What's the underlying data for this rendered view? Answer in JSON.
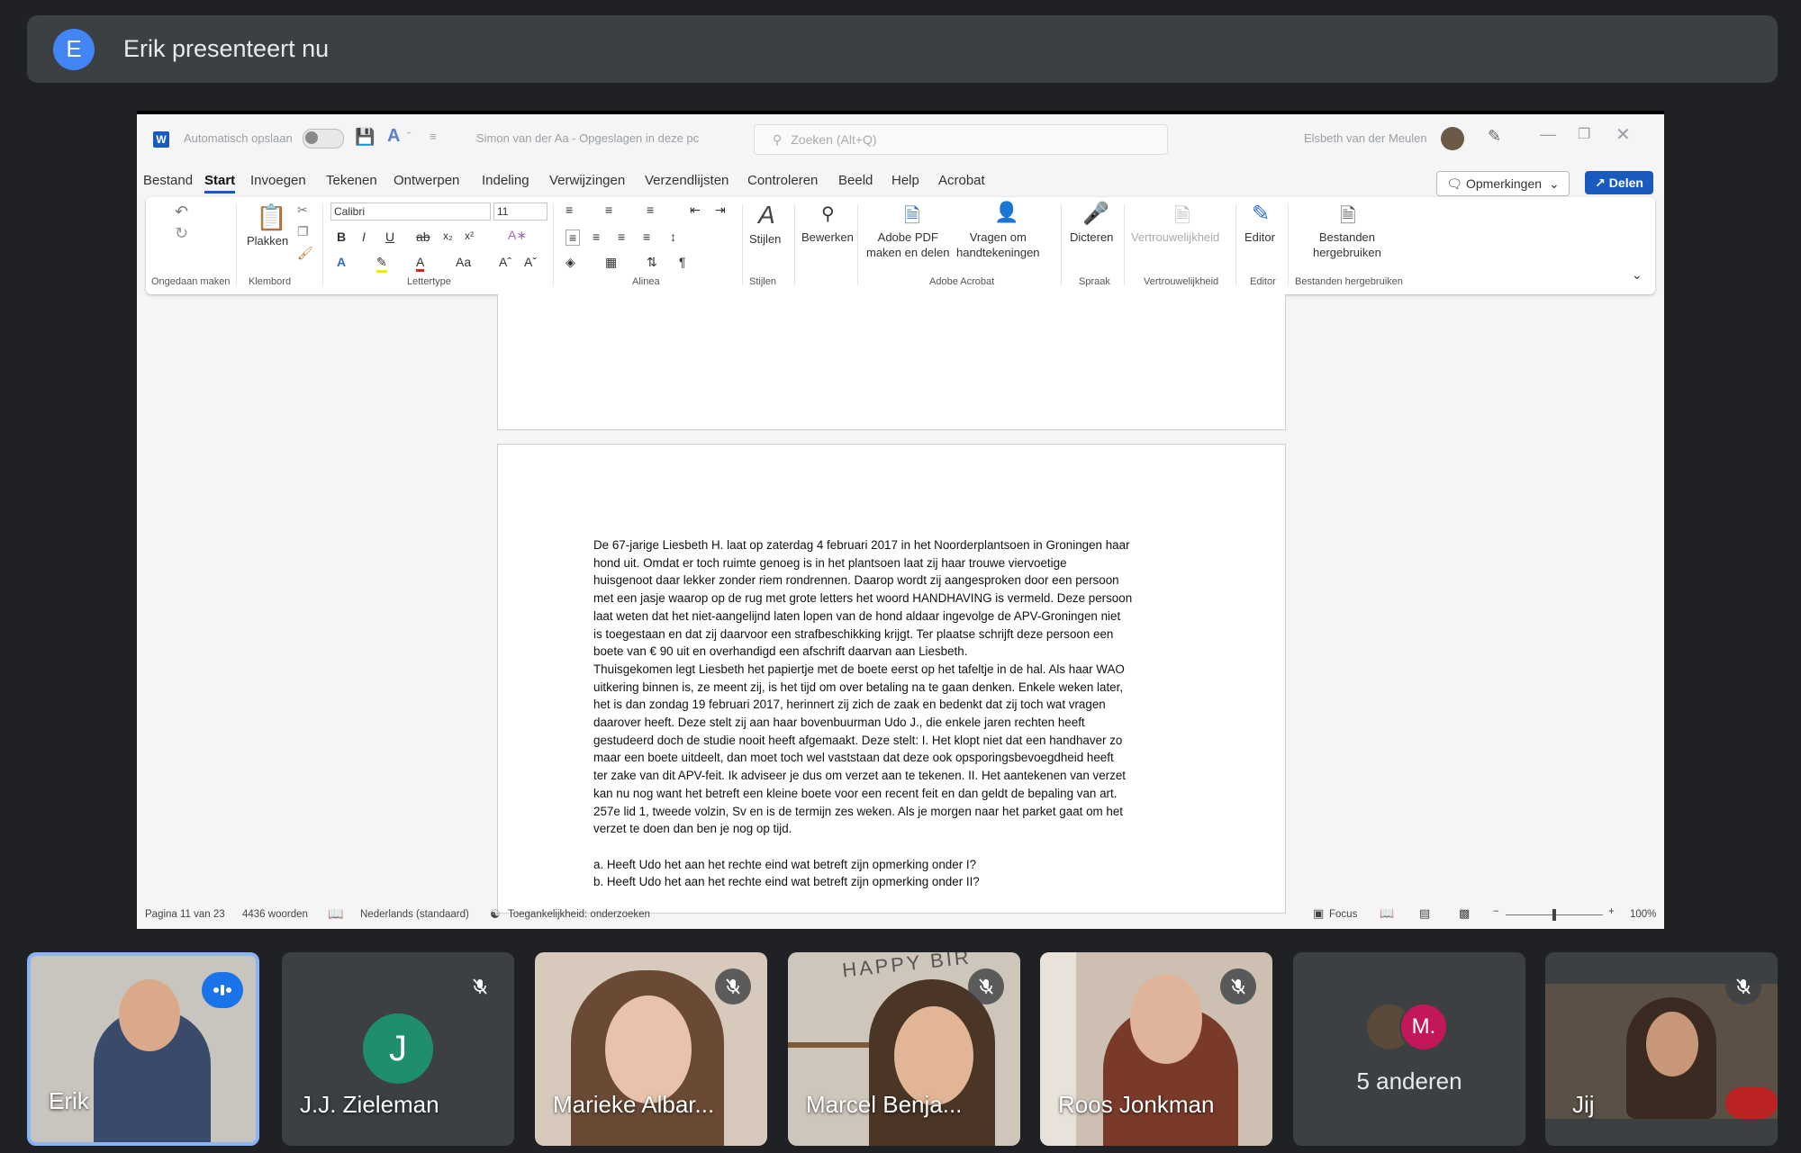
{
  "banner": {
    "avatar_letter": "E",
    "text": "Erik presenteert nu"
  },
  "word": {
    "autosave_label": "Automatisch opslaan",
    "doc_title": "Simon van der Aa  -  Opgeslagen in deze pc",
    "search_placeholder": "Zoeken (Alt+Q)",
    "user_name": "Elsbeth van der Meulen",
    "tabs": [
      "Bestand",
      "Start",
      "Invoegen",
      "Tekenen",
      "Ontwerpen",
      "Indeling",
      "Verwijzingen",
      "Verzendlijsten",
      "Controleren",
      "Beeld",
      "Help",
      "Acrobat"
    ],
    "comments_label": "Opmerkingen",
    "share_label": "Delen",
    "ribbon": {
      "paste_label": "Plakken",
      "font_name": "Calibri",
      "font_size": "11",
      "styles_label": "Stijlen",
      "edit_label": "Bewerken",
      "adobe_pdf_line1": "Adobe PDF",
      "adobe_pdf_line2": "maken en delen",
      "signatures_line1": "Vragen om",
      "signatures_line2": "handtekeningen",
      "dictate_label": "Dicteren",
      "sensitivity_label": "Vertrouwelijkheid",
      "editor_label": "Editor",
      "reuse_line1": "Bestanden",
      "reuse_line2": "hergebruiken",
      "groups": [
        "Ongedaan maken",
        "Klembord",
        "Lettertype",
        "Alinea",
        "Stijlen",
        "Adobe Acrobat",
        "Spraak",
        "Vertrouwelijkheid",
        "Editor",
        "Bestanden hergebruiken"
      ]
    },
    "document_lines": [
      "De 67-jarige Liesbeth H. laat op zaterdag 4 februari 2017 in het Noorderplantsoen in Groningen haar",
      "hond uit. Omdat er toch ruimte genoeg is in het plantsoen laat zij haar trouwe viervoetige",
      "huisgenoot daar lekker zonder riem rondrennen. Daarop wordt zij aangesproken door een persoon",
      "met een jasje waarop op de rug met grote letters het woord HANDHAVING is vermeld. Deze persoon",
      "laat weten dat het niet-aangelijnd laten lopen van de hond aldaar ingevolge de APV-Groningen niet",
      "is toegestaan en dat zij daarvoor een strafbeschikking krijgt. Ter plaatse schrijft deze persoon een",
      "boete van € 90 uit en overhandigd een afschrift daarvan aan Liesbeth.",
      "Thuisgekomen legt Liesbeth het papiertje met de boete eerst op het tafeltje in de hal. Als haar WAO",
      "uitkering binnen is, ze meent zij, is het tijd om over betaling na te gaan denken. Enkele weken later,",
      "het is dan zondag 19 februari 2017, herinnert zij zich de zaak en bedenkt dat zij toch wat vragen",
      "daarover heeft. Deze stelt zij aan haar bovenbuurman Udo J., die enkele jaren rechten heeft",
      "gestudeerd doch de studie nooit heeft afgemaakt. Deze stelt: I. Het klopt niet dat een handhaver zo",
      "maar een boete uitdeelt, dan moet toch wel vaststaan dat deze ook opsporingsbevoegdheid heeft",
      "ter zake van dit APV-feit. Ik adviseer je dus om verzet aan te tekenen. II. Het aantekenen van verzet",
      "kan nu nog want het betreft een kleine boete voor een recent feit en dan geldt de bepaling van art.",
      "257e lid 1, tweede volzin, Sv en is de termijn zes weken. Als je morgen naar het parket gaat om het",
      "verzet te doen dan ben je nog op tijd.",
      "",
      "a. Heeft Udo het aan het rechte eind wat betreft zijn opmerking onder I?",
      "b. Heeft Udo het aan het rechte eind wat betreft zijn opmerking onder II?"
    ],
    "status": {
      "page": "Pagina 11 van 23",
      "words": "4436 woorden",
      "language": "Nederlands (standaard)",
      "accessibility": "Toegankelijkheid: onderzoeken",
      "focus": "Focus",
      "zoom": "100%"
    }
  },
  "participants": [
    {
      "name": "Erik",
      "state": "speaking"
    },
    {
      "name": "J.J. Zieleman",
      "initial": "J",
      "state": "muted",
      "avatar_color": "#1e8e6e"
    },
    {
      "name": "Marieke Albar...",
      "state": "muted"
    },
    {
      "name": "Marcel Benja...",
      "state": "muted",
      "poster_text": "HAPPY BIR"
    },
    {
      "name": "Roos Jonkman",
      "state": "muted"
    },
    {
      "name": "5 anderen",
      "initial": "M.",
      "avatar_color": "#c2185b"
    },
    {
      "name": "Jij",
      "state": "muted"
    }
  ]
}
